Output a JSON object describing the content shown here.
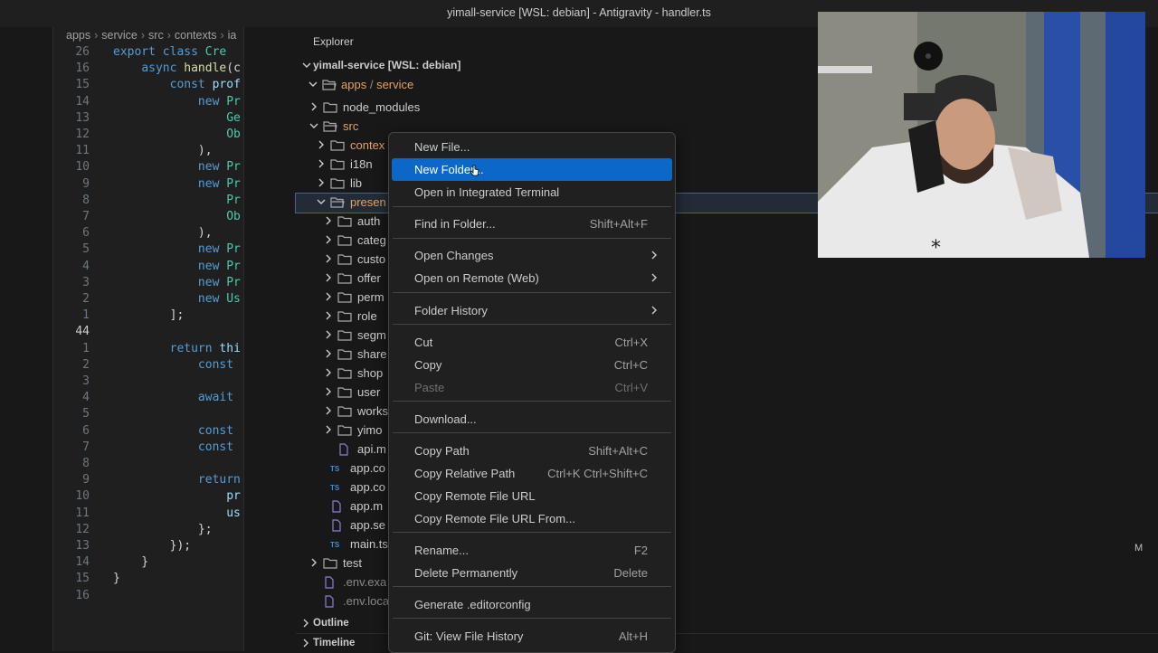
{
  "window": {
    "title": "yimall-service [WSL: debian] - Antigravity - handler.ts"
  },
  "editor": {
    "breadcrumb": [
      "apps",
      "service",
      "src",
      "contexts",
      "ia"
    ],
    "lines": [
      {
        "n": "26",
        "code": "export class Cre"
      },
      {
        "n": "16",
        "code": "    async handle(c"
      },
      {
        "n": "15",
        "code": "        const prof"
      },
      {
        "n": "14",
        "code": "            new Pr"
      },
      {
        "n": "13",
        "code": "                Ge"
      },
      {
        "n": "12",
        "code": "                Ob"
      },
      {
        "n": "11",
        "code": "            ),"
      },
      {
        "n": "10",
        "code": "            new Pr"
      },
      {
        "n": "9",
        "code": "            new Pr"
      },
      {
        "n": "8",
        "code": "                Pr"
      },
      {
        "n": "7",
        "code": "                Ob"
      },
      {
        "n": "6",
        "code": "            ),"
      },
      {
        "n": "5",
        "code": "            new Pr"
      },
      {
        "n": "4",
        "code": "            new Pr"
      },
      {
        "n": "3",
        "code": "            new Pr"
      },
      {
        "n": "2",
        "code": "            new Us"
      },
      {
        "n": "1",
        "code": "        ];"
      },
      {
        "n": "44",
        "code": ""
      },
      {
        "n": "1",
        "code": "        return thi"
      },
      {
        "n": "2",
        "code": "            const"
      },
      {
        "n": "3",
        "code": ""
      },
      {
        "n": "4",
        "code": "            await"
      },
      {
        "n": "5",
        "code": ""
      },
      {
        "n": "6",
        "code": "            const"
      },
      {
        "n": "7",
        "code": "            const"
      },
      {
        "n": "8",
        "code": ""
      },
      {
        "n": "9",
        "code": "            return"
      },
      {
        "n": "10",
        "code": "                pr"
      },
      {
        "n": "11",
        "code": "                us"
      },
      {
        "n": "12",
        "code": "            };"
      },
      {
        "n": "13",
        "code": "        });"
      },
      {
        "n": "14",
        "code": "    }"
      },
      {
        "n": "15",
        "code": "}"
      },
      {
        "n": "16",
        "code": ""
      }
    ]
  },
  "explorer": {
    "header": "Explorer",
    "root": "yimall-service [WSL: debian]",
    "apps_path": "apps",
    "apps_path_sep": "/",
    "service": "service",
    "items": [
      {
        "label": "node_modules",
        "kind": "folder"
      },
      {
        "label": "src",
        "kind": "folder-open"
      },
      {
        "label": "contex",
        "kind": "folder"
      },
      {
        "label": "i18n",
        "kind": "folder"
      },
      {
        "label": "lib",
        "kind": "folder"
      },
      {
        "label": "presen",
        "kind": "folder-open"
      },
      {
        "label": "auth",
        "kind": "folder"
      },
      {
        "label": "categ",
        "kind": "folder"
      },
      {
        "label": "custo",
        "kind": "folder"
      },
      {
        "label": "offer",
        "kind": "folder"
      },
      {
        "label": "perm",
        "kind": "folder"
      },
      {
        "label": "role",
        "kind": "folder"
      },
      {
        "label": "segm",
        "kind": "folder"
      },
      {
        "label": "share",
        "kind": "folder"
      },
      {
        "label": "shop",
        "kind": "folder"
      },
      {
        "label": "user",
        "kind": "folder"
      },
      {
        "label": "works",
        "kind": "folder"
      },
      {
        "label": "yimo",
        "kind": "folder"
      },
      {
        "label": "api.m",
        "kind": "file"
      },
      {
        "label": "app.co",
        "kind": "ts"
      },
      {
        "label": "app.co",
        "kind": "ts"
      },
      {
        "label": "app.m",
        "kind": "file"
      },
      {
        "label": "app.se",
        "kind": "file"
      },
      {
        "label": "main.ts",
        "kind": "ts"
      },
      {
        "label": "test",
        "kind": "folder"
      },
      {
        "label": ".env.exa",
        "kind": "file"
      },
      {
        "label": ".env.loca",
        "kind": "file"
      }
    ],
    "ts_tag": "TS",
    "modified_badge": "M",
    "outline": "Outline",
    "timeline": "Timeline"
  },
  "context_menu": {
    "items": [
      {
        "label": "New File...",
        "key": ""
      },
      {
        "label": "New Folder...",
        "key": "",
        "highlighted": true
      },
      {
        "label": "Open in Integrated Terminal",
        "key": ""
      },
      {
        "label": "Find in Folder...",
        "key": "Shift+Alt+F"
      },
      {
        "label": "Open Changes",
        "key": "",
        "submenu": true
      },
      {
        "label": "Open on Remote (Web)",
        "key": "",
        "submenu": true
      },
      {
        "label": "Folder History",
        "key": "",
        "submenu": true
      },
      {
        "label": "Cut",
        "key": "Ctrl+X"
      },
      {
        "label": "Copy",
        "key": "Ctrl+C"
      },
      {
        "label": "Paste",
        "key": "Ctrl+V",
        "disabled": true
      },
      {
        "label": "Download...",
        "key": ""
      },
      {
        "label": "Copy Path",
        "key": "Shift+Alt+C"
      },
      {
        "label": "Copy Relative Path",
        "key": "Ctrl+K Ctrl+Shift+C"
      },
      {
        "label": "Copy Remote File URL",
        "key": ""
      },
      {
        "label": "Copy Remote File URL From...",
        "key": ""
      },
      {
        "label": "Rename...",
        "key": "F2"
      },
      {
        "label": "Delete Permanently",
        "key": "Delete"
      },
      {
        "label": "Generate .editorconfig",
        "key": ""
      },
      {
        "label": "Git: View File History",
        "key": "Alt+H"
      }
    ]
  },
  "colors": {
    "accent": "#0c68c8",
    "background": "#181818",
    "editor_bg": "#1f1f1f"
  },
  "webcam": {
    "kind": "webcam-overlay"
  }
}
